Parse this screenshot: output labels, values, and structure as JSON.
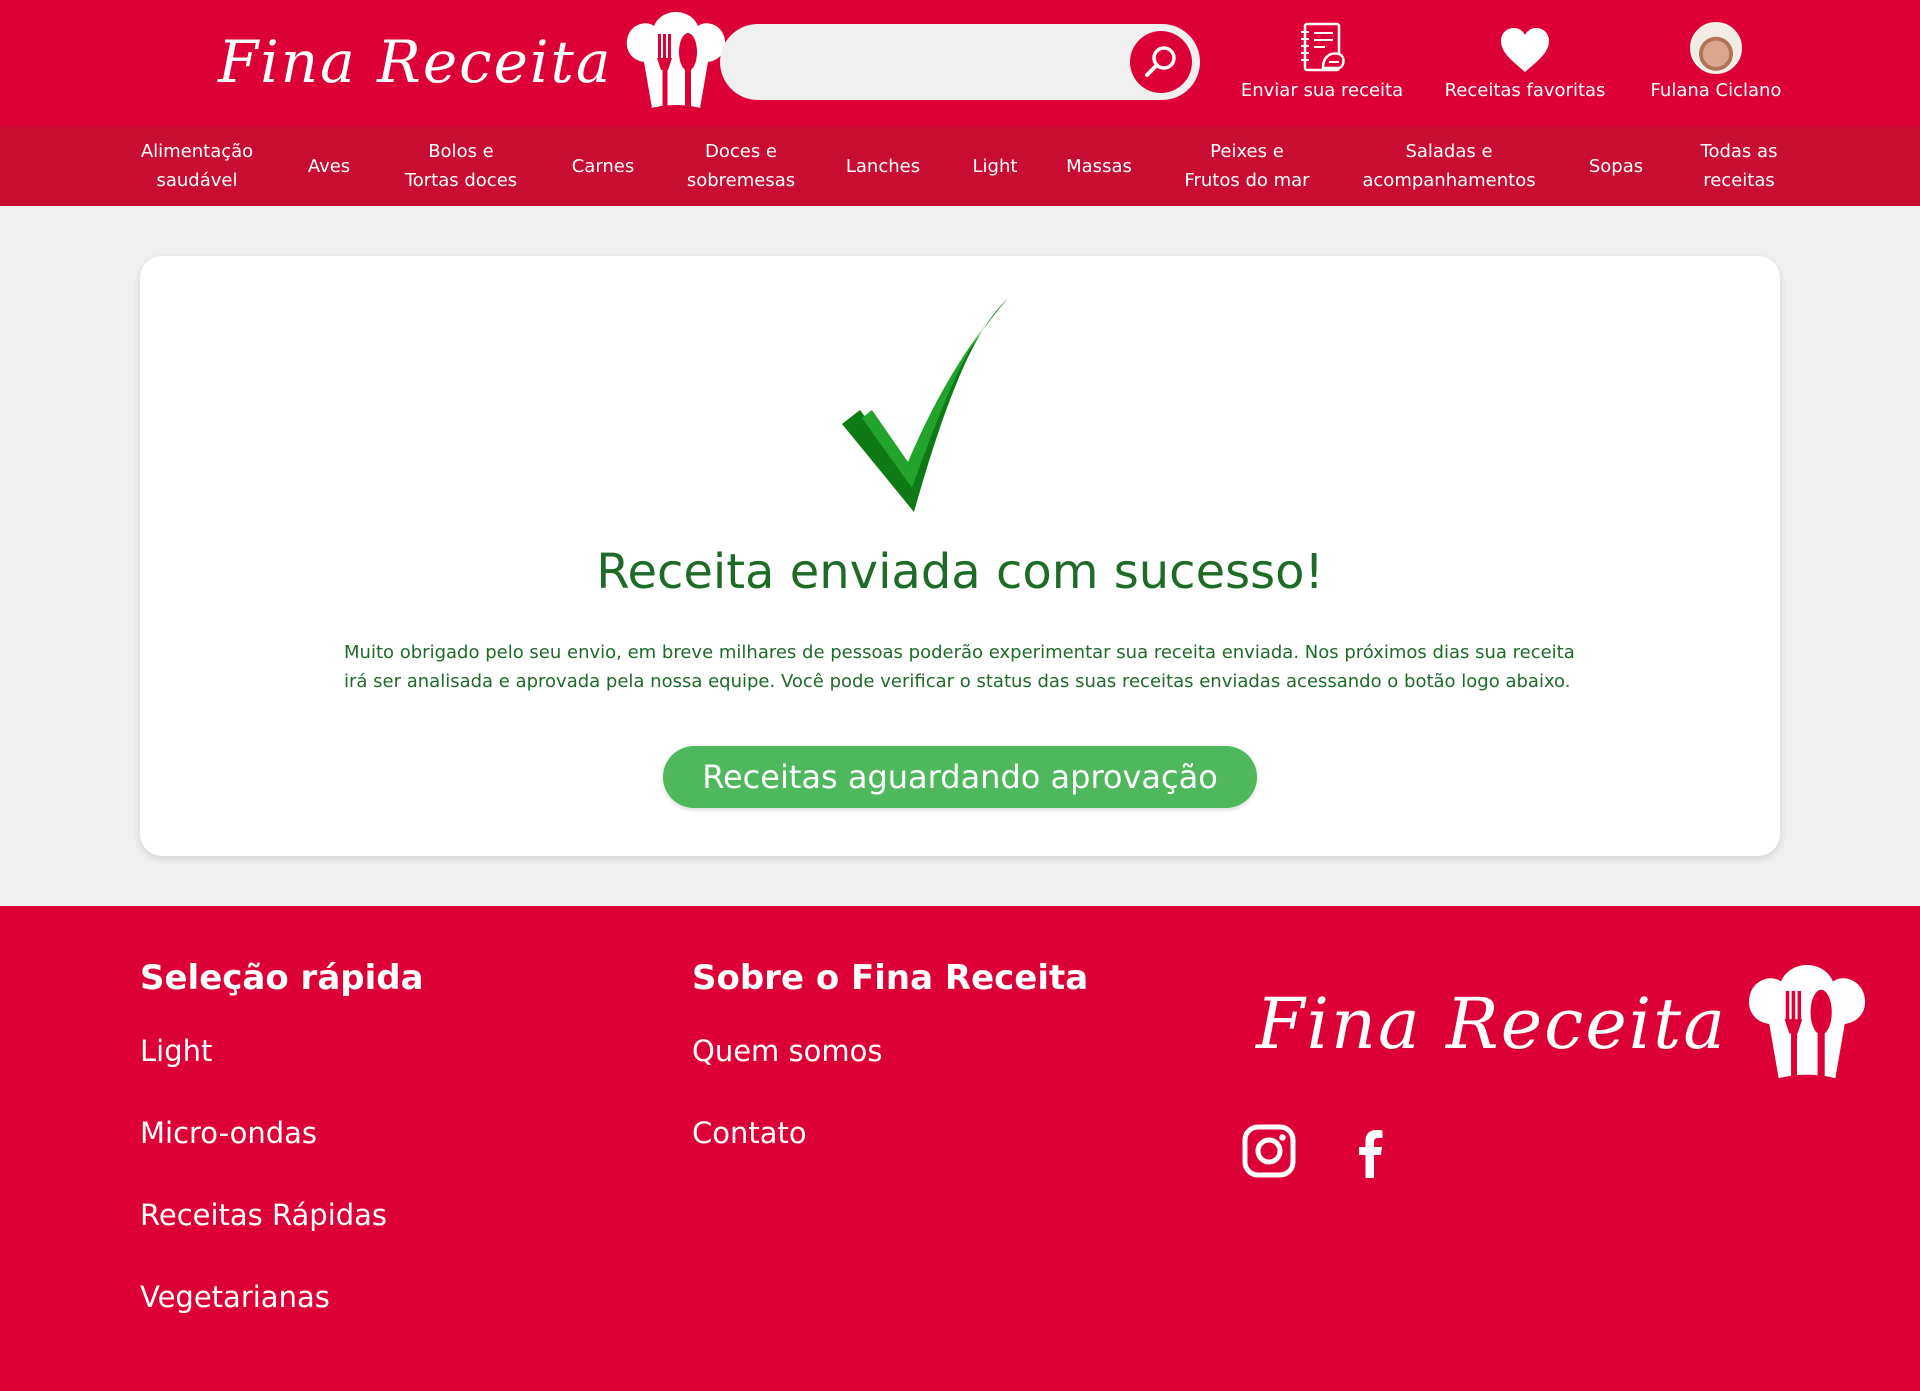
{
  "brand": {
    "name": "Fina Receita"
  },
  "search": {
    "placeholder": "",
    "icon": "search-icon"
  },
  "header_actions": {
    "send_recipe": {
      "label": "Enviar sua receita",
      "icon": "recipe-book-icon"
    },
    "favorites": {
      "label": "Receitas favoritas",
      "icon": "heart-icon"
    },
    "user": {
      "label": "Fulana Ciclano",
      "icon": "avatar"
    }
  },
  "nav": {
    "items": [
      {
        "label": "Alimentação\nsaudável"
      },
      {
        "label": "Aves"
      },
      {
        "label": "Bolos e\nTortas doces"
      },
      {
        "label": "Carnes"
      },
      {
        "label": "Doces e\nsobremesas"
      },
      {
        "label": "Lanches"
      },
      {
        "label": "Light"
      },
      {
        "label": "Massas"
      },
      {
        "label": "Peixes e\nFrutos do mar"
      },
      {
        "label": "Saladas e\nacompanhamentos"
      },
      {
        "label": "Sopas"
      },
      {
        "label": "Todas as\nreceitas"
      }
    ]
  },
  "main": {
    "icon": "checkmark-icon",
    "title": "Receita enviada com sucesso!",
    "message": "Muito obrigado pelo seu envio, em breve milhares de pessoas poderão experimentar sua receita enviada. Nos próximos dias sua receita irá ser analisada e aprovada pela nossa equipe. Você pode verificar o status das suas receitas enviadas acessando o botão logo abaixo.",
    "button_label": "Receitas aguardando aprovação"
  },
  "footer": {
    "quick": {
      "title": "Seleção rápida",
      "links": [
        "Light",
        "Micro-ondas",
        "Receitas Rápidas",
        "Vegetarianas"
      ]
    },
    "about": {
      "title": "Sobre o Fina Receita",
      "links": [
        "Quem somos",
        "Contato"
      ]
    },
    "social": [
      "instagram-icon",
      "facebook-icon"
    ]
  },
  "colors": {
    "brand_red": "#dc0036",
    "nav_red": "#c90d32",
    "success_green": "#1e6b27",
    "button_green": "#4fb85c",
    "page_bg": "#f0f0f0"
  }
}
